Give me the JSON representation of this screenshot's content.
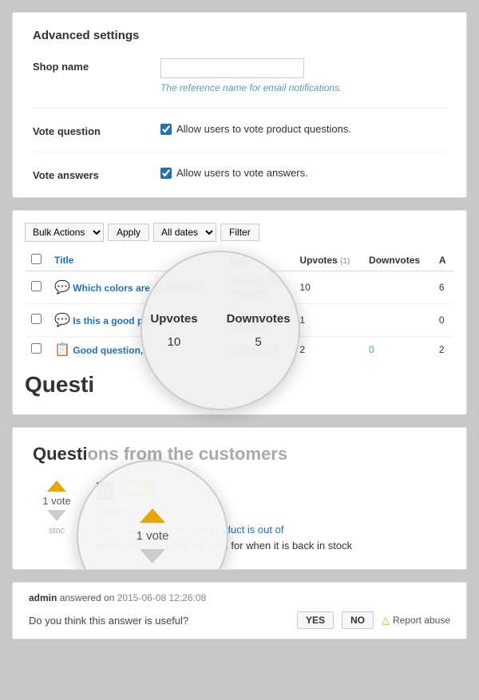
{
  "advanced_settings": {
    "title": "Advanced settings",
    "shop_name": {
      "label": "Shop name",
      "placeholder": "",
      "hint": "The reference name for email notifications."
    },
    "vote_question": {
      "label": "Vote question",
      "checked": true,
      "text": "Allow users to vote product questions."
    },
    "vote_answers": {
      "label": "Vote answers",
      "checked": true,
      "text": "Allow users to vote answers."
    }
  },
  "toolbar": {
    "bulk_actions_label": "Bulk Actions",
    "apply_label": "Apply",
    "all_dates_label": "All dates",
    "filter_label": "Filter"
  },
  "table": {
    "columns": [
      "Title",
      "Date",
      "Upvotes",
      "Downvotes",
      "A"
    ],
    "rows": [
      {
        "title": "Which colors are avalilable?",
        "date": "4 hours ago",
        "status": "Published",
        "upvotes": "10",
        "upvotes_note": "(1)",
        "downvotes": "",
        "answers": "6"
      },
      {
        "title": "Is this a good product?",
        "date": "4 hours ago",
        "status": "Published",
        "upvotes": "1",
        "upvotes_note": "",
        "downvotes": "",
        "answers": "0"
      },
      {
        "title": "Good question,",
        "date": "2015/06/26",
        "status": "",
        "upvotes": "2",
        "upvotes_note": "",
        "downvotes": "0",
        "answers": "2"
      }
    ]
  },
  "magnifier1": {
    "header1": "Upvotes",
    "header2": "Downvotes",
    "val1": "10",
    "val2": "5"
  },
  "frontend": {
    "title": "Questions from the customers",
    "vote_count": "1 vote",
    "vote_label": "vote",
    "answer_label": "Answ",
    "answer_question": "stock?",
    "answer_intro": "stock?",
    "answer_body": "No, it isn't, but when the product is out of",
    "answer_body2": "stock, you can book the item for when it is back in stock"
  },
  "magnifier2": {
    "vote_count": "1 vote",
    "vote_label": "vote"
  },
  "answer_footer": {
    "author": "admin",
    "action": "answered on",
    "timestamp": "2015-06-08 12:26:08",
    "feedback_question": "Do you think this answer is useful?",
    "yes_label": "YES",
    "no_label": "NO",
    "report_label": "Report abuse"
  }
}
